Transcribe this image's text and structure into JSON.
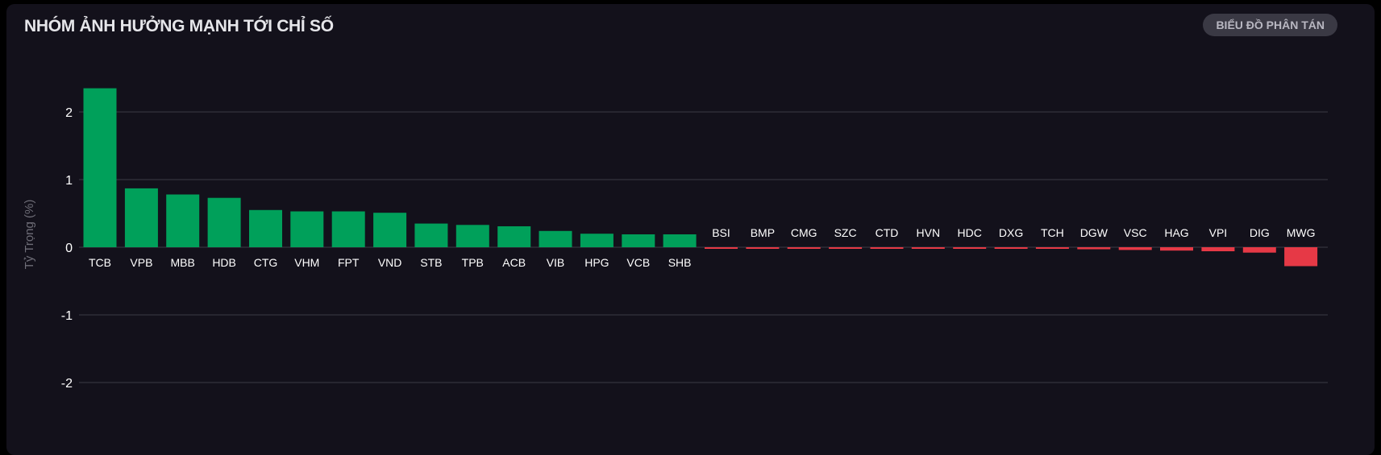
{
  "header": {
    "title": "NHÓM ẢNH HƯỞNG MẠNH TỚI CHỈ SỐ",
    "scatter_button": "BIỂU ĐỒ PHÂN TÁN"
  },
  "colors": {
    "positive": "#00a05a",
    "negative": "#e63946",
    "grid": "#3b3a45",
    "background": "#13111b"
  },
  "chart_data": {
    "type": "bar",
    "title": "",
    "xlabel": "",
    "ylabel": "Tỷ Trọng (%)",
    "ylim": [
      -2.2,
      2.4
    ],
    "yticks": [
      2,
      1,
      0,
      -1,
      -2
    ],
    "grid": true,
    "categories": [
      "TCB",
      "VPB",
      "MBB",
      "HDB",
      "CTG",
      "VHM",
      "FPT",
      "VND",
      "STB",
      "TPB",
      "ACB",
      "VIB",
      "HPG",
      "VCB",
      "SHB",
      "BSI",
      "BMP",
      "CMG",
      "SZC",
      "CTD",
      "HVN",
      "HDC",
      "DXG",
      "TCH",
      "DGW",
      "VSC",
      "HAG",
      "VPI",
      "DIG",
      "MWG"
    ],
    "values": [
      2.35,
      0.87,
      0.78,
      0.73,
      0.55,
      0.53,
      0.53,
      0.51,
      0.35,
      0.33,
      0.31,
      0.24,
      0.2,
      0.19,
      0.19,
      -0.01,
      -0.01,
      -0.01,
      -0.02,
      -0.02,
      -0.02,
      -0.02,
      -0.02,
      -0.02,
      -0.03,
      -0.04,
      -0.05,
      -0.06,
      -0.08,
      -0.28
    ]
  }
}
